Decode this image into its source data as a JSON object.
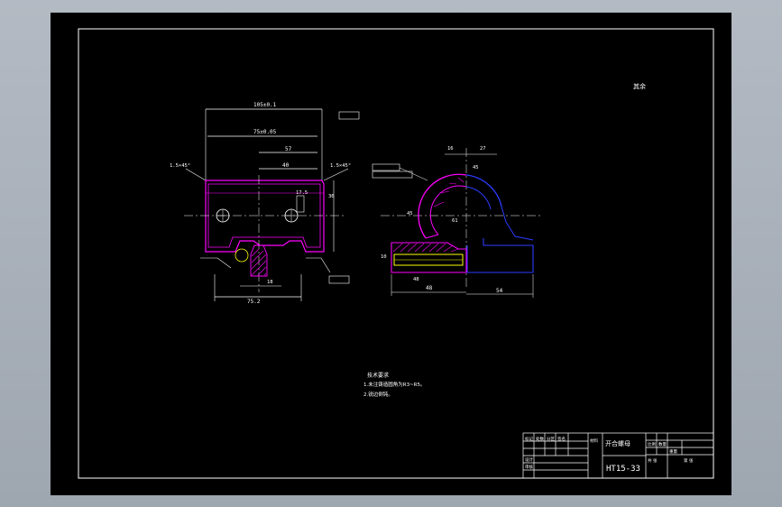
{
  "drawing": {
    "top_right_note": "其余",
    "title": "开合螺母",
    "drawing_number": "HT15-33",
    "tech_req_heading": "技术要求",
    "tech_req_line1": "1.未注铸造圆角为R3~R5。",
    "tech_req_line2": "2.锐边倒钝。",
    "dim_top_overall": "105±0.1",
    "dim_second": "75±0.05",
    "dim_third": "57",
    "dim_fourth": "40",
    "chamfer_left": "1.5×45°",
    "chamfer_right": "1.5×45°",
    "dim_fifth": "17.5",
    "dim_side": "36",
    "dim_bottom": "75.2",
    "dim_bottom_small": "18",
    "dim_right_view_a": "48",
    "dim_right_view_b": "54",
    "dim_right_view_c": "48",
    "dim_right_view_d": "10",
    "dim_right_view_e": "45",
    "dim_right_view_f": "16",
    "dim_right_view_g": "27",
    "dim_right_view_h": "45",
    "dim_right_view_i": "61"
  },
  "title_block": {
    "scale_label": "比例",
    "qty_label": "数量",
    "weight_label": "重量",
    "material_label": "材料",
    "designer_label": "设计",
    "checker_label": "审核",
    "cell_a": "标记",
    "cell_b": "处数",
    "cell_c": "分区",
    "cell_d": "签名",
    "sheet_label": "共 张",
    "sheet_label2": "第 张"
  },
  "colors": {
    "background": "#000000",
    "frame": "#ffffff",
    "outline": "#ff00ff",
    "hatch": "#ff00ff",
    "blue_part": "#2b3cff",
    "yellow_part": "#ffff00",
    "centerline": "#ffffff"
  }
}
